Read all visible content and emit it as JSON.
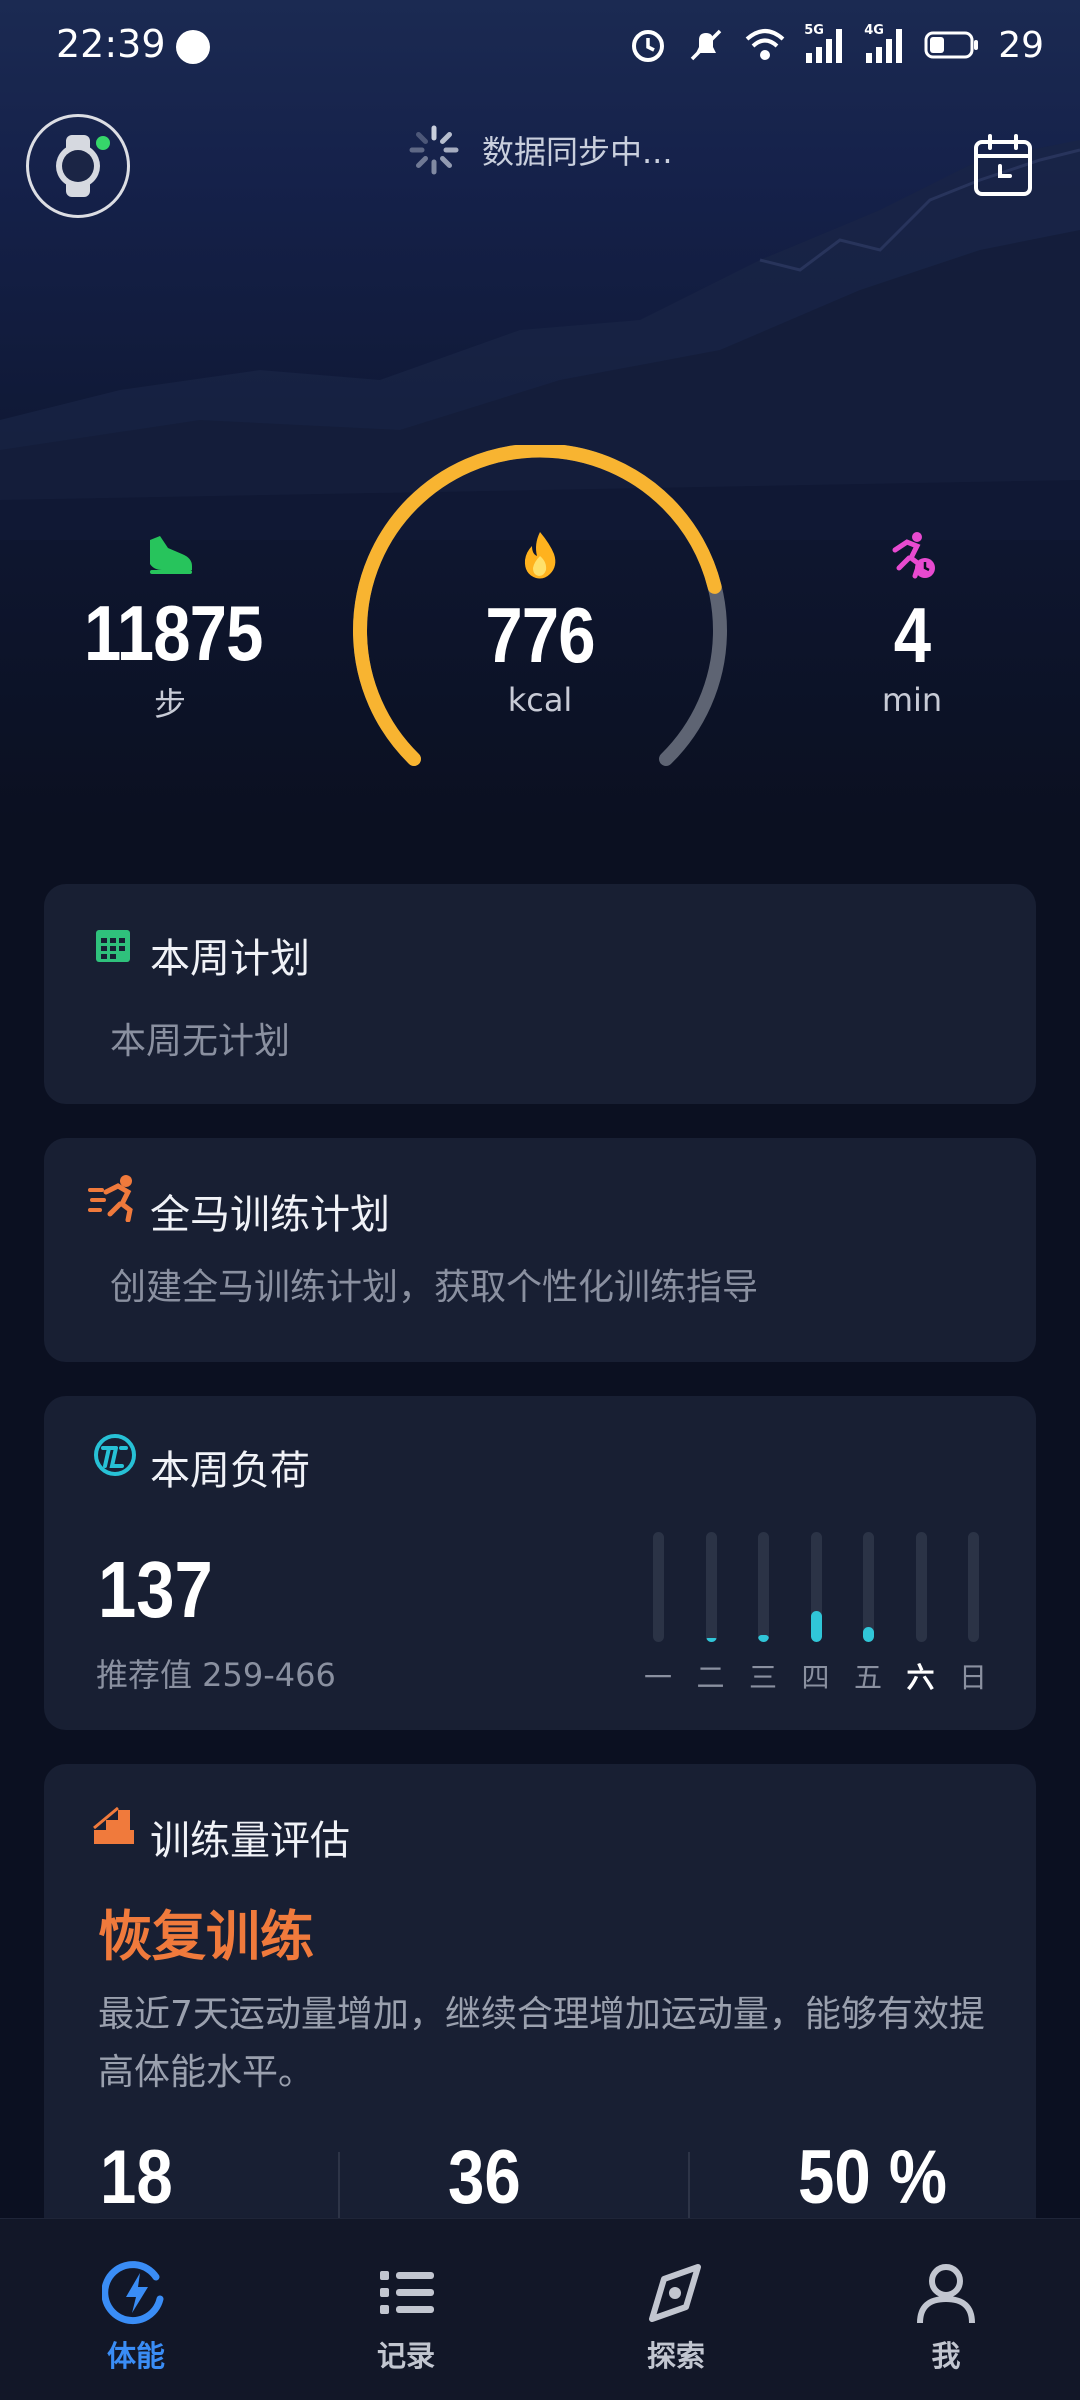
{
  "status_bar": {
    "time": "22:39",
    "network_5g": "5G",
    "network_4g": "4G",
    "battery": "29"
  },
  "header": {
    "sync_text": "数据同步中..."
  },
  "stats": {
    "steps": {
      "value": "11875",
      "unit": "步"
    },
    "calories": {
      "value": "776",
      "unit": "kcal",
      "ring_progress": 0.78
    },
    "active_minutes": {
      "value": "4",
      "unit": "min"
    }
  },
  "weekly_plan": {
    "title": "本周计划",
    "subtitle": "本周无计划"
  },
  "marathon_plan": {
    "title": "全马训练计划",
    "subtitle": "创建全马训练计划，获取个性化训练指导"
  },
  "weekly_load": {
    "title": "本周负荷",
    "value": "137",
    "recommended": "推荐值 259-466",
    "days": [
      {
        "label": "一",
        "level": 0.0,
        "today": false
      },
      {
        "label": "二",
        "level": 0.03,
        "today": false
      },
      {
        "label": "三",
        "level": 0.06,
        "today": false
      },
      {
        "label": "四",
        "level": 0.28,
        "today": false
      },
      {
        "label": "五",
        "level": 0.14,
        "today": false
      },
      {
        "label": "六",
        "level": 0.0,
        "today": true
      },
      {
        "label": "日",
        "level": 0.0,
        "today": false
      }
    ]
  },
  "training_assessment": {
    "title": "训练量评估",
    "status": "恢复训练",
    "description": "最近7天运动量增加，继续合理增加运动量，能够有效提高体能水平。",
    "numbers": [
      "18",
      "36",
      "50 %"
    ]
  },
  "bottom_nav": [
    {
      "label": "体能",
      "icon": "lightning-circle-icon",
      "active": true
    },
    {
      "label": "记录",
      "icon": "list-icon",
      "active": false
    },
    {
      "label": "探索",
      "icon": "compass-icon",
      "active": false
    },
    {
      "label": "我",
      "icon": "person-icon",
      "active": false
    }
  ],
  "colors": {
    "accent_blue": "#3a8df6",
    "ring_orange": "#f8b431",
    "load_cyan": "#30c6d8",
    "status_orange": "#f07a3c",
    "card_bg": "#181f33"
  }
}
